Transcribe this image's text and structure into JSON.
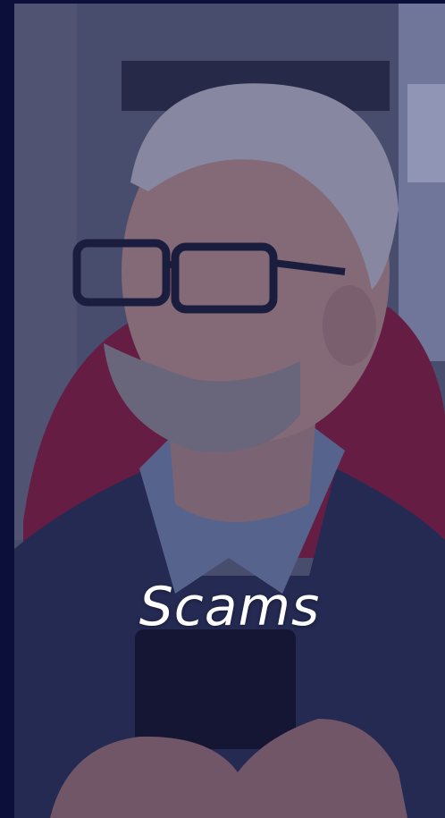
{
  "card": {
    "title": "Scams",
    "image_alt": "man-with-glasses-holding-phone-photo"
  },
  "colors": {
    "background": "#0c0f3a",
    "overlay_tint": "#181a5a",
    "title_text": "#ffffff"
  }
}
